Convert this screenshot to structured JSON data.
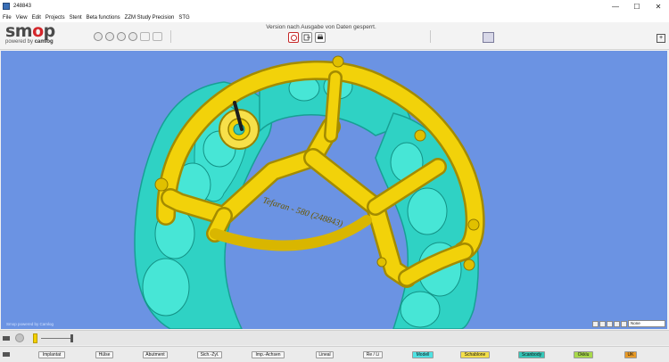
{
  "window": {
    "title": "248843",
    "minimize": "—",
    "maximize": "☐",
    "close": "✕"
  },
  "menu": [
    "File",
    "View",
    "Edit",
    "Projects",
    "Stent",
    "Beta functions",
    "ZZM Study Precision",
    "STG"
  ],
  "logo": {
    "word_prefix": "sm",
    "word_o": "o",
    "word_suffix": "p",
    "tagline_prefix": "powered by ",
    "tagline_brand": "camlog"
  },
  "toolbar": {
    "left_icons": [
      "eye-icon",
      "tooth-icon",
      "camera-icon",
      "camera-icon",
      "curve-icon",
      "curve-icon"
    ],
    "status_message": "Version nach Ausgabe von Daten gesperrt.",
    "center_icons": [
      "stop-icon",
      "export-icon",
      "print-icon"
    ],
    "expand": "+"
  },
  "viewport": {
    "watermark": "Smop powered by Camlog",
    "template_label": "Tefaran - 580 (248843)",
    "view_select": "None",
    "colors": {
      "background": "#6b93e3",
      "model": "#2fd2c4",
      "template": "#f2d20a",
      "sleeve": "#f7e04a"
    }
  },
  "filters": [
    {
      "label": "Implantat",
      "color": "#f6f6f6"
    },
    {
      "label": "Hülse",
      "color": "#f6f6f6"
    },
    {
      "label": "Abutment",
      "color": "#f6f6f6"
    },
    {
      "label": "Sich.-Zyl.",
      "color": "#f6f6f6"
    },
    {
      "label": "Imp.-Achsen",
      "color": "#f6f6f6"
    },
    {
      "label": "Lineal",
      "color": "#f6f6f6"
    },
    {
      "label": "Re / Li",
      "color": "#f6f6f6"
    },
    {
      "label": "Modell",
      "color": "#4fe3e3"
    },
    {
      "label": "Schablone",
      "color": "#f4e04a"
    },
    {
      "label": "Scanbody",
      "color": "#35c6b7"
    },
    {
      "label": "Okklu",
      "color": "#a8d94b"
    },
    {
      "label": "UK",
      "color": "#e89a27"
    }
  ]
}
